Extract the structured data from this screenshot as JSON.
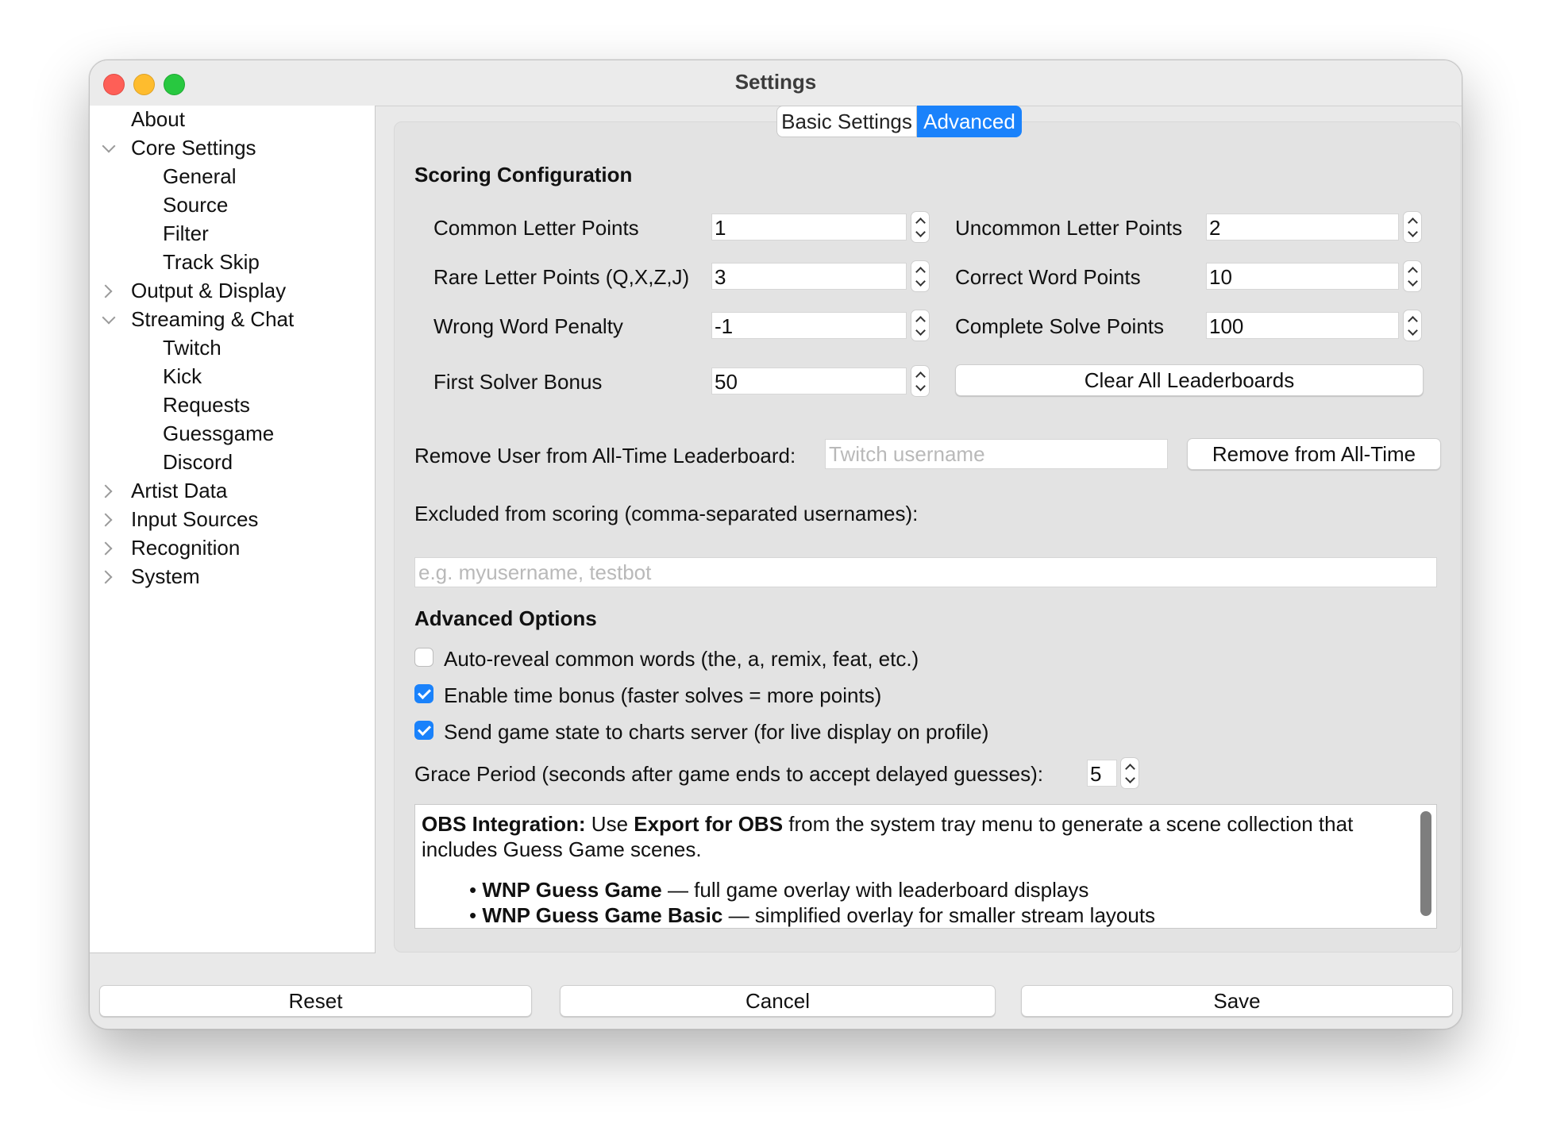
{
  "window": {
    "title": "Settings"
  },
  "sidebar": {
    "items": [
      {
        "label": "About",
        "level": 0,
        "chevron": "none"
      },
      {
        "label": "Core Settings",
        "level": 0,
        "chevron": "down"
      },
      {
        "label": "General",
        "level": 1,
        "chevron": "none"
      },
      {
        "label": "Source",
        "level": 1,
        "chevron": "none"
      },
      {
        "label": "Filter",
        "level": 1,
        "chevron": "none"
      },
      {
        "label": "Track Skip",
        "level": 1,
        "chevron": "none"
      },
      {
        "label": "Output & Display",
        "level": 0,
        "chevron": "right"
      },
      {
        "label": "Streaming & Chat",
        "level": 0,
        "chevron": "down"
      },
      {
        "label": "Twitch",
        "level": 1,
        "chevron": "none"
      },
      {
        "label": "Kick",
        "level": 1,
        "chevron": "none"
      },
      {
        "label": "Requests",
        "level": 1,
        "chevron": "none"
      },
      {
        "label": "Guessgame",
        "level": 1,
        "chevron": "none"
      },
      {
        "label": "Discord",
        "level": 1,
        "chevron": "none"
      },
      {
        "label": "Artist Data",
        "level": 0,
        "chevron": "right"
      },
      {
        "label": "Input Sources",
        "level": 0,
        "chevron": "right"
      },
      {
        "label": "Recognition",
        "level": 0,
        "chevron": "right"
      },
      {
        "label": "System",
        "level": 0,
        "chevron": "right"
      }
    ]
  },
  "tabs": {
    "basic": "Basic Settings",
    "advanced": "Advanced",
    "active_color": "#1a82fb"
  },
  "scoring": {
    "heading": "Scoring Configuration",
    "common_letter": {
      "label": "Common Letter Points",
      "value": "1"
    },
    "uncommon_letter": {
      "label": "Uncommon Letter Points",
      "value": "2"
    },
    "rare_letter": {
      "label": "Rare Letter Points (Q,X,Z,J)",
      "value": "3"
    },
    "correct_word": {
      "label": "Correct Word Points",
      "value": "10"
    },
    "wrong_word": {
      "label": "Wrong Word Penalty",
      "value": "-1"
    },
    "complete_solve": {
      "label": "Complete Solve Points",
      "value": "100"
    },
    "first_solver": {
      "label": "First Solver Bonus",
      "value": "50"
    },
    "clear_button": "Clear All Leaderboards"
  },
  "remove_user": {
    "label": "Remove User from All-Time Leaderboard:",
    "placeholder": "Twitch username",
    "button": "Remove from All-Time"
  },
  "excluded": {
    "label": "Excluded from scoring (comma-separated usernames):",
    "placeholder": "e.g. myusername, testbot"
  },
  "advanced_options": {
    "heading": "Advanced Options",
    "auto_reveal": {
      "label": "Auto-reveal common words (the, a, remix, feat, etc.)",
      "checked": false
    },
    "time_bonus": {
      "label": "Enable time bonus (faster solves = more points)",
      "checked": true
    },
    "send_state": {
      "label": "Send game state to charts server (for live display on profile)",
      "checked": true
    },
    "grace_period": {
      "label": "Grace Period (seconds after game ends to accept delayed guesses):",
      "value": "5"
    }
  },
  "obs_info": {
    "lead_bold": "OBS Integration:",
    "text1": " Use ",
    "bold2": "Export for OBS",
    "text2": " from the system tray menu to generate a scene collection that includes Guess Game scenes.",
    "bullets": [
      {
        "marker": "•",
        "bold": "WNP Guess Game",
        "text": " — full game overlay with leaderboard displays"
      },
      {
        "marker": "•",
        "bold": "WNP Guess Game Basic",
        "text": " — simplified overlay for smaller stream layouts"
      }
    ]
  },
  "footer": {
    "reset": "Reset",
    "cancel": "Cancel",
    "save": "Save"
  }
}
